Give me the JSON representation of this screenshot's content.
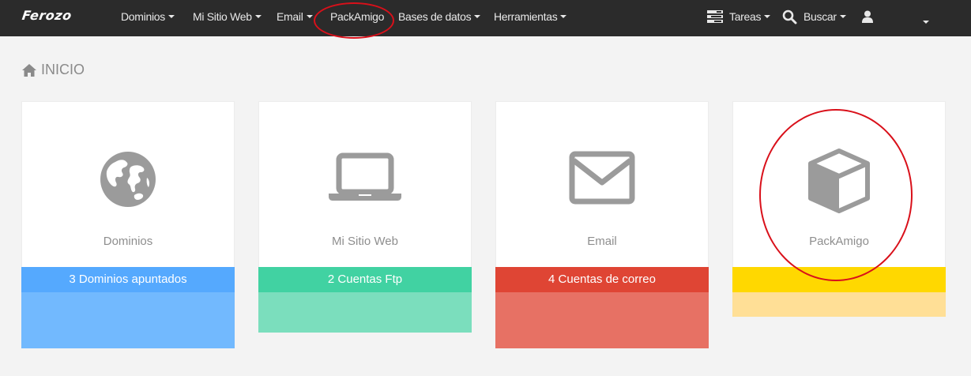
{
  "navbar": {
    "brand": "Ferozo",
    "menu": [
      {
        "label": "Dominios",
        "dropdown": true
      },
      {
        "label": "Mi Sitio Web",
        "dropdown": true
      },
      {
        "label": "Email",
        "dropdown": true
      },
      {
        "label": "PackAmigo",
        "dropdown": false
      },
      {
        "label": "Bases de datos",
        "dropdown": true
      },
      {
        "label": "Herramientas",
        "dropdown": true
      }
    ],
    "tasks_label": "Tareas",
    "search_label": "Buscar",
    "tasks_icon": "tasks-icon",
    "search_icon": "search-icon",
    "user_icon": "user-icon"
  },
  "page": {
    "title": "INICIO",
    "title_icon": "home-icon"
  },
  "cards": [
    {
      "label": "Dominios",
      "icon": "globe-icon",
      "band_text": "3 Dominios apuntados",
      "band_color": "#55a9fe",
      "foot_color": "#72b9fe"
    },
    {
      "label": "Mi Sitio Web",
      "icon": "laptop-icon",
      "band_text": "2 Cuentas Ftp",
      "band_color": "#41d2a2",
      "foot_color": "#7bdebd"
    },
    {
      "label": "Email",
      "icon": "envelope-icon",
      "band_text": "4 Cuentas de correo",
      "band_color": "#df4534",
      "foot_color": "#e77164"
    },
    {
      "label": "PackAmigo",
      "icon": "cube-icon",
      "band_text": "",
      "band_color": "#ffd800",
      "foot_color": "#ffdf96"
    }
  ],
  "colors": {
    "navbar_bg": "#2b2b2b",
    "page_bg": "#f3f3f3",
    "icon_gray": "#9b9b9b",
    "highlight_ring": "#d9101a"
  }
}
